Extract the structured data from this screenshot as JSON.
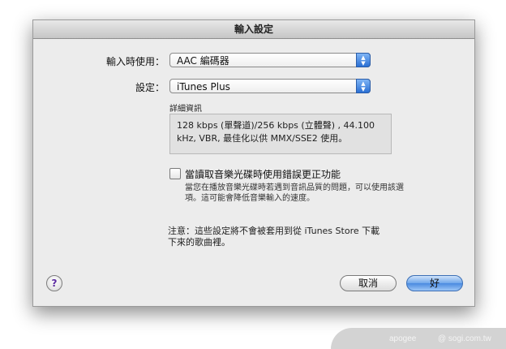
{
  "window": {
    "title": "輸入設定"
  },
  "import_using": {
    "label": "輸入時使用：",
    "selected": "AAC 編碼器"
  },
  "setting": {
    "label": "設定：",
    "selected": "iTunes Plus"
  },
  "details": {
    "label": "詳細資訊",
    "text": "128 kbps (單聲道)/256 kbps (立體聲) , 44.100 kHz, VBR, 最佳化以供 MMX/SSE2 使用。"
  },
  "error_correction": {
    "checked": false,
    "label": "當讀取音樂光碟時使用錯誤更正功能",
    "description": "當您在播放音樂光碟時若遇到音訊品質的問題，可以使用該選項。這可能會降低音樂輸入的速度。"
  },
  "note": {
    "text": "注意：這些設定將不會被套用到從 iTunes Store 下載下來的歌曲裡。"
  },
  "help": {
    "glyph": "?"
  },
  "buttons": {
    "cancel": "取消",
    "ok": "好"
  },
  "watermark": {
    "left": "apogee",
    "right": "@ sogi.com.tw"
  },
  "colors": {
    "accent_blue": "#4a8ae0",
    "window_bg": "#ececec",
    "help_glyph": "#5b2aa0"
  }
}
